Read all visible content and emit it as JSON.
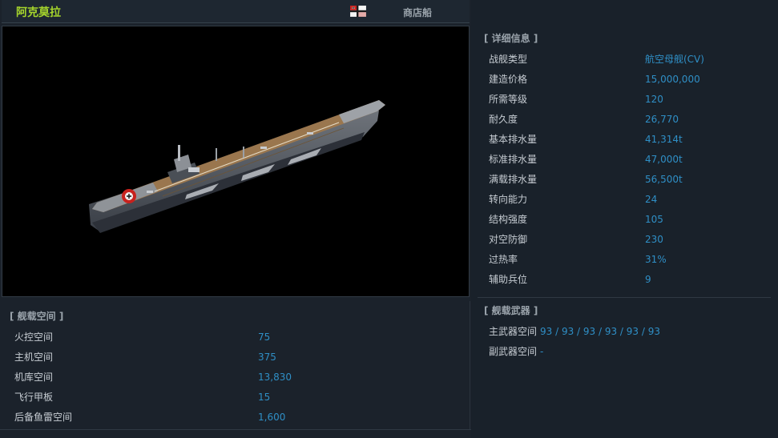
{
  "header": {
    "ship_name": "阿克莫拉",
    "flag_icon": "german-naval-ensign-icon",
    "shop_label": "商店船"
  },
  "detail_info": {
    "title": "[ 详细信息 ]",
    "rows": [
      {
        "label": "战舰类型",
        "value": "航空母舰(CV)"
      },
      {
        "label": "建造价格",
        "value": "15,000,000"
      },
      {
        "label": "所需等级",
        "value": "120"
      },
      {
        "label": "耐久度",
        "value": "26,770"
      },
      {
        "label": "基本排水量",
        "value": "41,314t"
      },
      {
        "label": "标准排水量",
        "value": "47,000t"
      },
      {
        "label": "满载排水量",
        "value": "56,500t"
      },
      {
        "label": "转向能力",
        "value": "24"
      },
      {
        "label": "结构强度",
        "value": "105"
      },
      {
        "label": "对空防御",
        "value": "230"
      },
      {
        "label": "过热率",
        "value": "31%"
      },
      {
        "label": "辅助兵位",
        "value": "9"
      }
    ]
  },
  "ship_space": {
    "title": "[ 舰载空间 ]",
    "rows": [
      {
        "label": "火控空间",
        "value": "75"
      },
      {
        "label": "主机空间",
        "value": "375"
      },
      {
        "label": "机库空间",
        "value": "13,830"
      },
      {
        "label": "飞行甲板",
        "value": "15"
      },
      {
        "label": "后备鱼雷空间",
        "value": "1,600"
      }
    ]
  },
  "ship_weapons": {
    "title": "[ 舰载武器 ]",
    "rows": [
      {
        "label": "主武器空间",
        "value": "93 / 93 / 93 / 93 / 93 / 93"
      },
      {
        "label": "副武器空间",
        "value": "-"
      }
    ]
  },
  "colors": {
    "ship_name": "#a5d42c",
    "value_text": "#2f8fc6",
    "label_text": "#c6ccd2",
    "background": "#1b222b"
  }
}
